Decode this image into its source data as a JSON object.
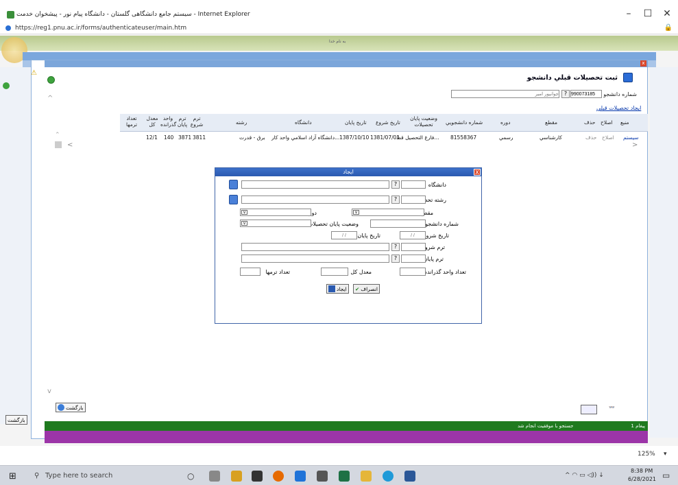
{
  "window": {
    "title": "سیستم جامع دانشگاهی گلستان - دانشگاه پیام نور - پیشخوان خدمت - Internet Explorer",
    "url": "https://reg1.pnu.ac.ir/forms/authenticateuser/main.htm"
  },
  "banner": {
    "slogan": "به نام خدا"
  },
  "form": {
    "title": "ثبت تحصيلات قبلي دانشجو",
    "student_number_label": "شماره دانشجو",
    "student_number_value": "990073185",
    "student_name_placeholder": "جوانپور امیر",
    "create_link": "ايجاد تحصيلات قبلي"
  },
  "grid": {
    "headers": [
      "منبع",
      "اصلاح",
      "حذف",
      "مقطع",
      "دوره",
      "شماره دانشجويي",
      "وضعيت پايان تحصيلات",
      "تاريخ شروع",
      "تاريخ پايان",
      "دانشگاه",
      "رشته",
      "ترم شروع",
      "ترم پايان",
      "واحد گذرانده",
      "معدل كل",
      "تعداد ترمها"
    ],
    "row": {
      "source": "سيستم",
      "edit": "اصلاح",
      "delete": "حذف",
      "level": "كارشناسي",
      "course": "رسمي",
      "student_no": "81558367",
      "status": "فارغ التحصيل قط...",
      "start_date": "1381/07/01",
      "end_date": "1387/10/10",
      "university": "دانشگاه آزاد اسلامي واحد كار...",
      "field": "برق - قدرت",
      "start_term": "3811",
      "end_term": "3871",
      "units": "140",
      "gpa": "12/1",
      "terms": ""
    }
  },
  "dialog": {
    "title": "ايجاد",
    "university_label": "دانشگاه",
    "field_label": "رشته تحصيلي",
    "level_label": "مقطع",
    "course_label": "دوره",
    "student_no_label": "شماره دانشجويي",
    "status_label": "وضعيت پايان تحصيلات",
    "start_date_label": "تاريخ شروع",
    "end_date_label": "تاريخ پايان",
    "date_placeholder": "/ /",
    "start_term_label": "ترم شروع",
    "end_term_label": "ترم پايان",
    "units_label": "تعداد واحد گذرانده",
    "gpa_label": "معدل كل",
    "terms_label": "تعداد ترمها",
    "create_button": "ايجاد",
    "cancel_button": "انصراف"
  },
  "status": {
    "page": "1 پيغام",
    "message": "جستجو با موفقيت انجام شد",
    "back_label": "بازگشت"
  },
  "zoom": "125%",
  "taskbar": {
    "search_placeholder": "Type here to search",
    "time": "8:38 PM",
    "date": "6/28/2021"
  }
}
